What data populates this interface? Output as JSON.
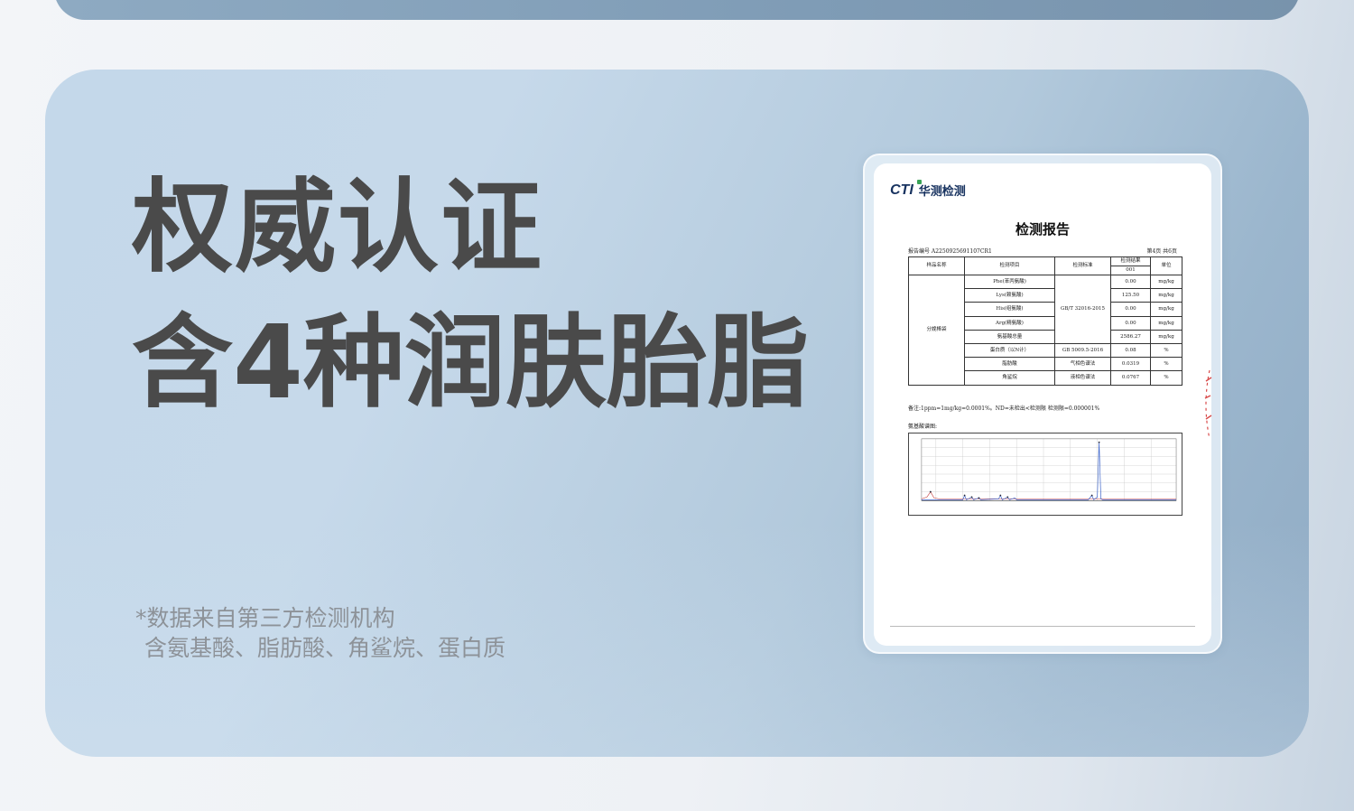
{
  "headline": {
    "line1": "权威认证",
    "line2": "含4种润肤胎脂"
  },
  "notes": {
    "line1": "*数据来自第三方检测机构",
    "line2": "含氨基酸、脂肪酸、角鲨烷、蛋白质"
  },
  "report": {
    "logo_cti": "CTI",
    "logo_cn": "华测检测",
    "title": "检测报告",
    "report_no": "报告编号    A2250925691107CR1",
    "page": "第4页  共6页",
    "headers": {
      "sample_name": "样品名称",
      "item": "检测项目",
      "standard": "检测标准",
      "result": "检测结果",
      "result_id": "001",
      "unit": "单位"
    },
    "sample": "分娩棒袋",
    "rows": [
      {
        "item": "Phe(苯丙氨酸)",
        "result": "0.00",
        "unit": "mg/kg"
      },
      {
        "item": "Lys(赖氨酸)",
        "result": "125.50",
        "unit": "mg/kg"
      },
      {
        "item": "His(组氨酸)",
        "result": "0.00",
        "unit": "mg/kg"
      },
      {
        "item": "Arg(精氨酸)",
        "result": "0.00",
        "unit": "mg/kg"
      },
      {
        "item": "氨基酸总量",
        "result": "2586.27",
        "unit": "mg/kg"
      },
      {
        "item": "蛋白质（以N计）",
        "result": "0.08",
        "unit": "%"
      },
      {
        "item": "脂肪酸",
        "result": "0.0319",
        "unit": "%"
      },
      {
        "item": "角鲨烷",
        "result": "0.0767",
        "unit": "%"
      }
    ],
    "standards": {
      "amino": "GB/T 32016-2015",
      "protein": "GB 5009.5-2016",
      "fatty": "气相色谱法",
      "squalane": "液相色谱法"
    },
    "footnote": "备注:1ppm=1mg/kg=0.0001%。ND=未检出<检测限  检测限=0.000001%",
    "chart_caption": "氨基酸谱图:"
  },
  "colors": {
    "headline": "#4a4a4a",
    "note": "#8d9298",
    "card_light": "#c4d8ea",
    "card_dark": "#90abc4",
    "logo": "#17325f",
    "chart_line": "#3a62c9"
  }
}
